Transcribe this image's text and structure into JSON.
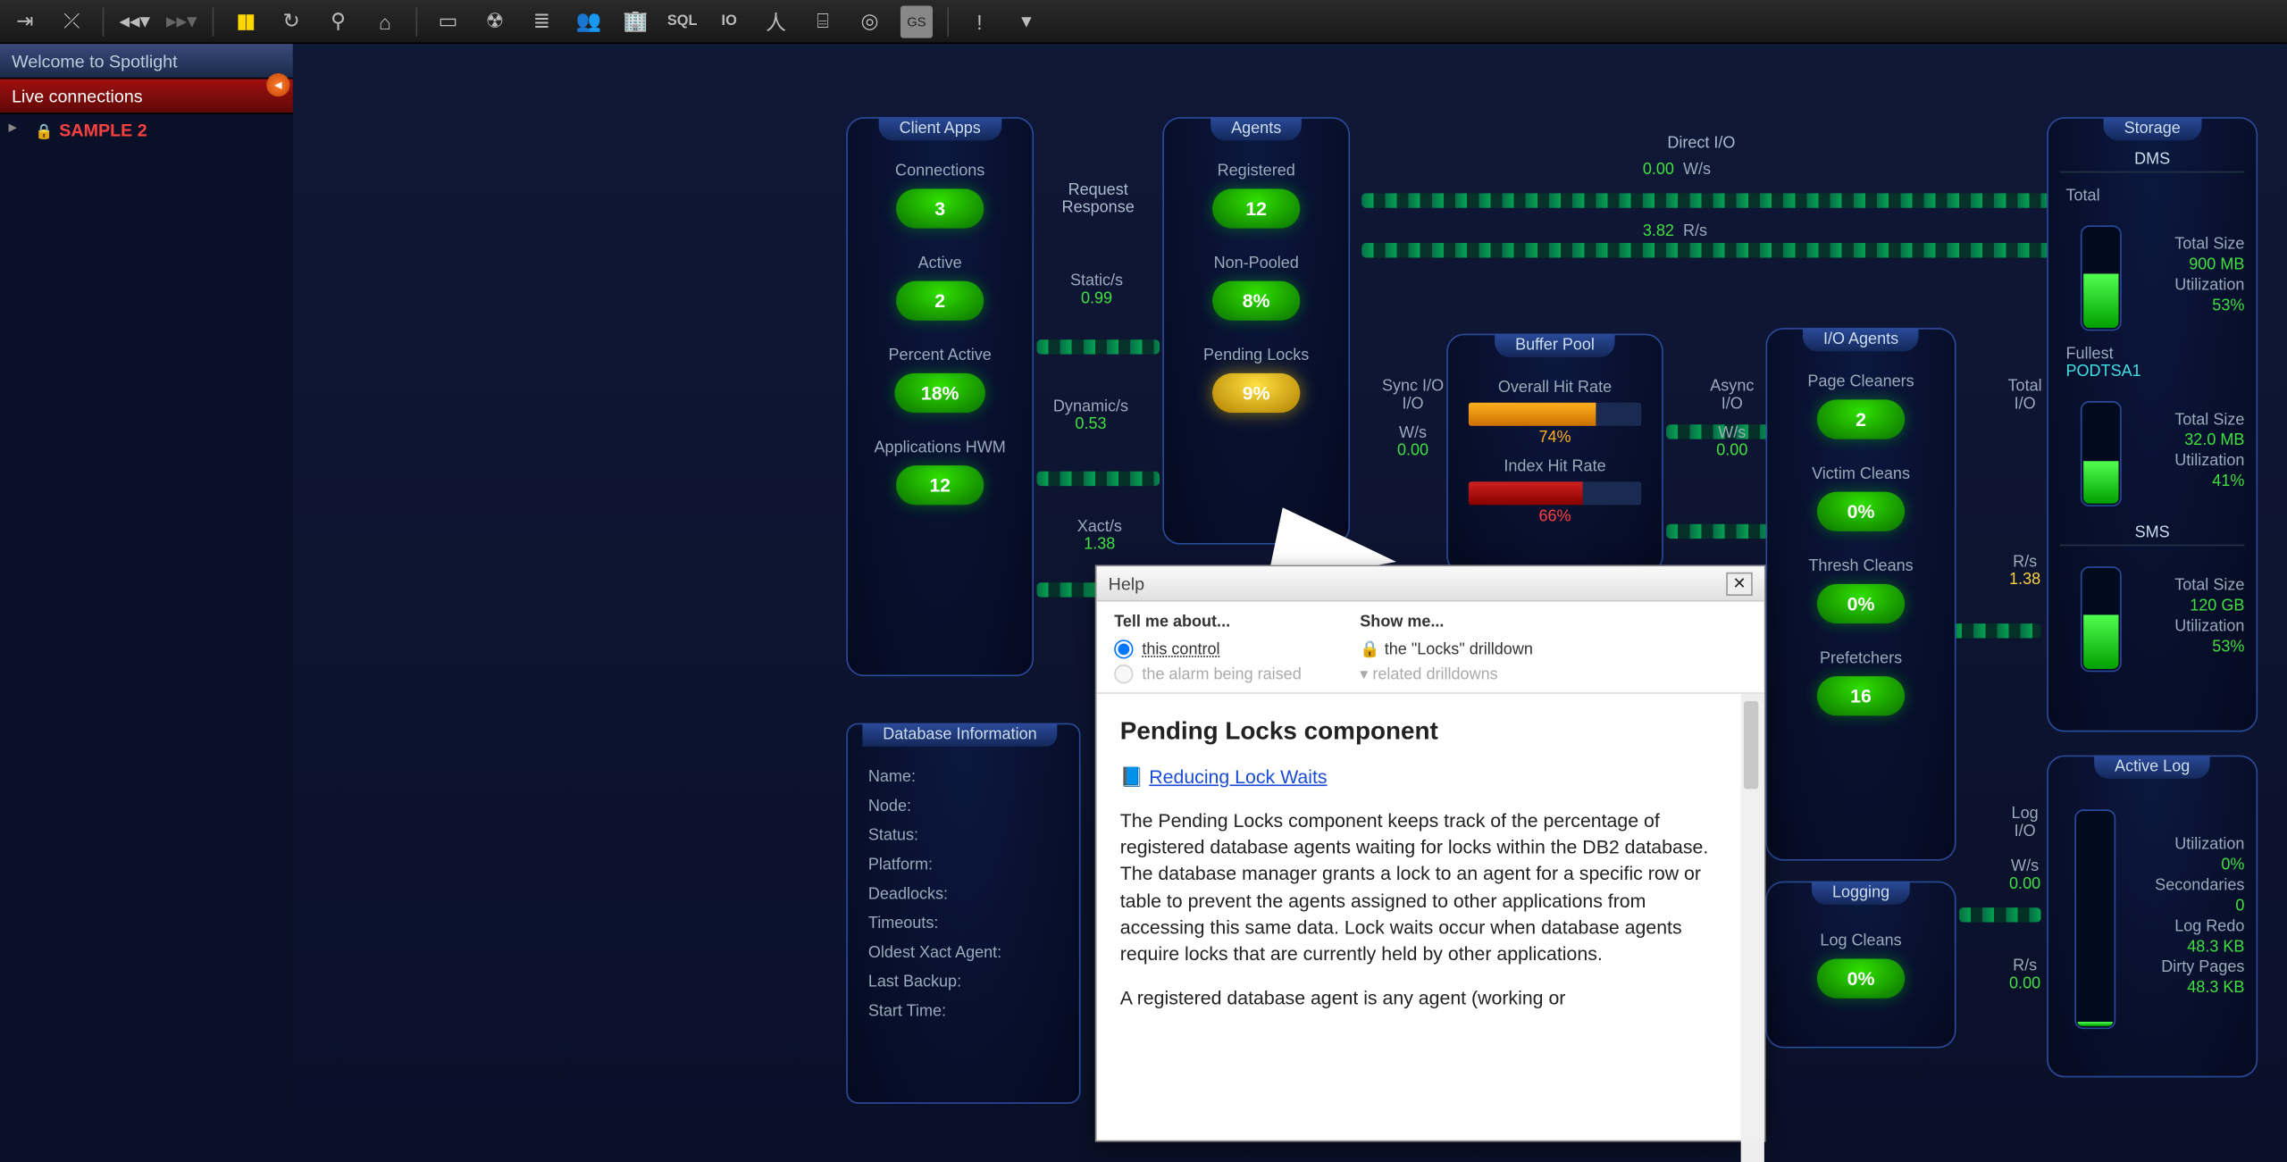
{
  "toolbar_icons": [
    "plug-in",
    "plug-out",
    "back",
    "fwd",
    "pause",
    "refresh",
    "pin",
    "home",
    "monitor",
    "radiation",
    "db",
    "users",
    "buildings",
    "sql",
    "io",
    "tripod",
    "cylinder",
    "disc",
    "gs",
    "alert",
    "menu"
  ],
  "sidebar": {
    "welcome": "Welcome to Spotlight",
    "live": "Live connections",
    "connection": "SAMPLE 2"
  },
  "client_apps": {
    "title": "Client Apps",
    "metrics": [
      {
        "label": "Connections",
        "value": "3"
      },
      {
        "label": "Active",
        "value": "2"
      },
      {
        "label": "Percent Active",
        "value": "18%"
      },
      {
        "label": "Applications HWM",
        "value": "12"
      }
    ]
  },
  "req_resp": {
    "head1": "Request",
    "head2": "Response",
    "rows": [
      {
        "label": "Static/s",
        "value": "0.99"
      },
      {
        "label": "Dynamic/s",
        "value": "0.53"
      },
      {
        "label": "Xact/s",
        "value": "1.38"
      }
    ]
  },
  "agents": {
    "title": "Agents",
    "metrics": [
      {
        "label": "Registered",
        "value": "12",
        "warn": false
      },
      {
        "label": "Non-Pooled",
        "value": "8%",
        "warn": false
      },
      {
        "label": "Pending Locks",
        "value": "9%",
        "warn": true
      }
    ]
  },
  "direct_io": {
    "label": "Direct I/O",
    "w": "0.00",
    "wlabel": "W/s",
    "r": "3.82",
    "rlabel": "R/s"
  },
  "sync_io": {
    "label": "Sync I/O",
    "sub": "I/O",
    "wlabel": "W/s",
    "w": "0.00"
  },
  "async_io": {
    "label": "Async",
    "sub": "I/O",
    "wlabel": "W/s",
    "w": "0.00"
  },
  "buffer_pool": {
    "title": "Buffer Pool",
    "overall_label": "Overall Hit Rate",
    "overall_pct": "74%",
    "overall_fill": 74,
    "index_label": "Index Hit Rate",
    "index_pct": "66%",
    "index_fill": 66
  },
  "io_agents": {
    "title": "I/O Agents",
    "metrics": [
      {
        "label": "Page Cleaners",
        "value": "2"
      },
      {
        "label": "Victim Cleans",
        "value": "0%"
      },
      {
        "label": "Thresh Cleans",
        "value": "0%"
      },
      {
        "label": "Prefetchers",
        "value": "16"
      }
    ]
  },
  "logging": {
    "title": "Logging",
    "metric_label": "Log Cleans",
    "metric_value": "0%"
  },
  "total_io": {
    "label": "Total",
    "sub": "I/O",
    "rlabel": "R/s",
    "r": "1.38"
  },
  "log_io": {
    "label": "Log",
    "sub": "I/O",
    "wlabel": "W/s",
    "w": "0.00",
    "rlabel": "R/s",
    "r": "0.00"
  },
  "storage": {
    "title": "Storage",
    "dms": {
      "head": "DMS",
      "total_label": "Total",
      "rows": [
        {
          "lbl": "Total Size",
          "val": "900 MB"
        },
        {
          "lbl": "Utilization",
          "val": "53%"
        }
      ],
      "fill": 53,
      "fullest_label": "Fullest",
      "fullest_name": "PODTSA1",
      "rows2": [
        {
          "lbl": "Total Size",
          "val": "32.0 MB"
        },
        {
          "lbl": "Utilization",
          "val": "41%"
        }
      ],
      "fill2": 41
    },
    "sms": {
      "head": "SMS",
      "rows": [
        {
          "lbl": "Total Size",
          "val": "120 GB"
        },
        {
          "lbl": "Utilization",
          "val": "53%"
        }
      ],
      "fill": 53
    }
  },
  "active_log": {
    "title": "Active Log",
    "rows": [
      {
        "lbl": "Utilization",
        "val": "0%"
      },
      {
        "lbl": "Secondaries",
        "val": "0"
      },
      {
        "lbl": "Log Redo",
        "val": "48.3 KB"
      },
      {
        "lbl": "Dirty Pages",
        "val": "48.3 KB"
      }
    ],
    "fill": 2
  },
  "db_info": {
    "title": "Database Information",
    "rows": [
      "Name:",
      "Node:",
      "Status:",
      "Platform:",
      "Deadlocks:",
      "Timeouts:",
      "Oldest Xact Agent:",
      "Last Backup:",
      "Start Time:"
    ]
  },
  "help": {
    "title": "Help",
    "tell_head": "Tell me about...",
    "show_head": "Show me...",
    "radio_this": "this control",
    "radio_alarm": "the alarm being raised",
    "show_link": "the \"Locks\" drilldown",
    "related": "related drilldowns",
    "body_title": "Pending Locks component",
    "ref_link": "Reducing Lock Waits",
    "para1": "The Pending Locks component keeps track of the percentage of registered database agents waiting for locks within the DB2 database. The database manager grants a lock to an agent for a specific row or table to prevent the agents assigned to other applications from accessing this same data. Lock waits occur when database agents require locks that are currently held by other applications.",
    "para2": "A registered database agent is any agent (working or"
  }
}
